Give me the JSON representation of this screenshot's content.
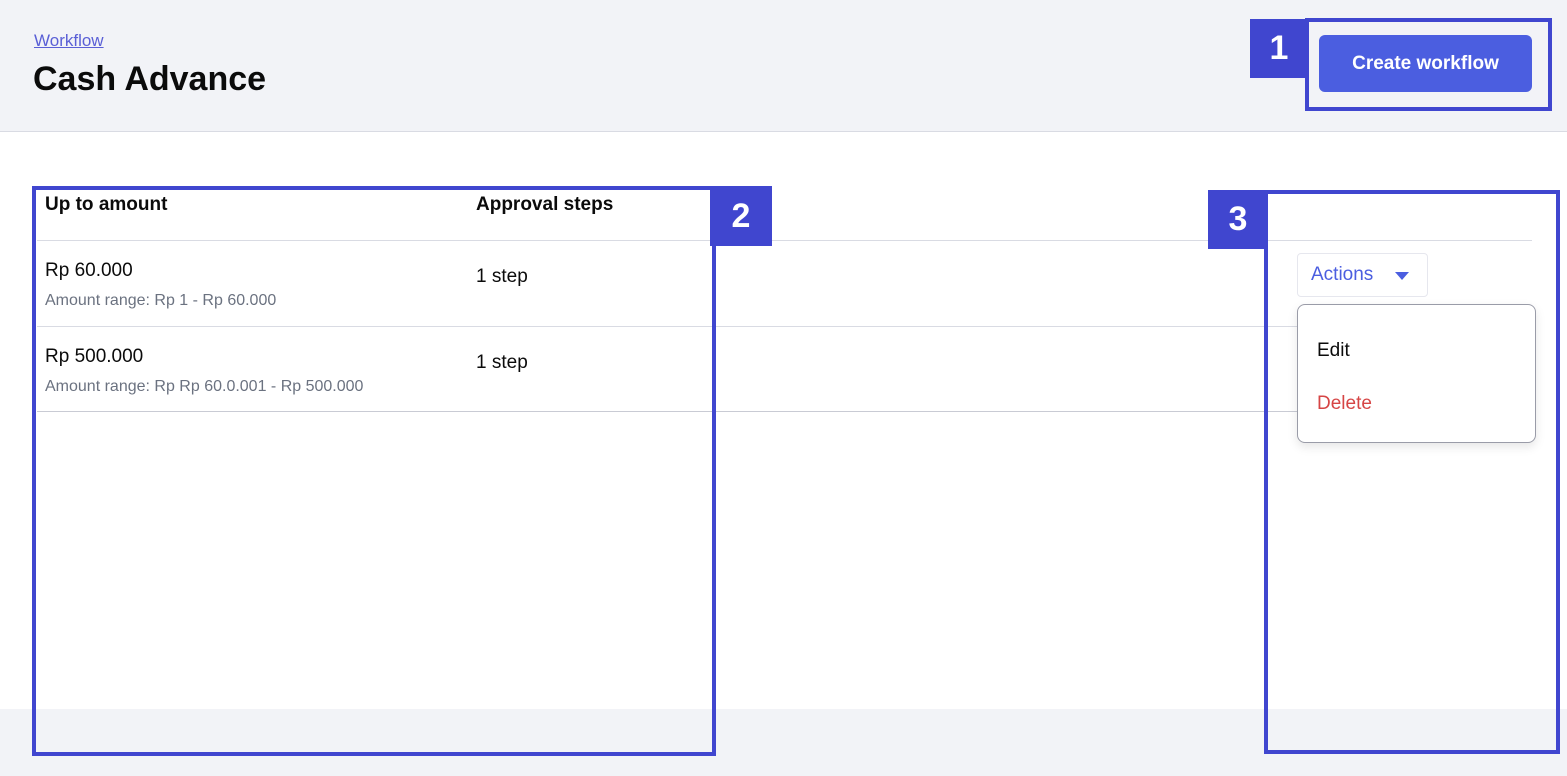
{
  "breadcrumb": {
    "workflow_link": "Workflow"
  },
  "page": {
    "title": "Cash Advance"
  },
  "toolbar": {
    "create_label": "Create workflow"
  },
  "table": {
    "headers": {
      "amount": "Up to amount",
      "steps": "Approval steps"
    },
    "rows": [
      {
        "amount": "Rp 60.000",
        "range": "Amount range: Rp 1 - Rp 60.000",
        "steps": "1 step"
      },
      {
        "amount": "Rp 500.000",
        "range": "Amount range: Rp Rp 60.0.001 - Rp 500.000",
        "steps": "1 step"
      }
    ]
  },
  "actions": {
    "label": "Actions",
    "menu": {
      "edit": "Edit",
      "delete": "Delete"
    }
  },
  "annotations": {
    "one": "1",
    "two": "2",
    "three": "3"
  },
  "colors": {
    "accent": "#4b5ee0",
    "annotation": "#4046cf",
    "danger": "#d64545",
    "header_bg": "#f2f3f7"
  }
}
